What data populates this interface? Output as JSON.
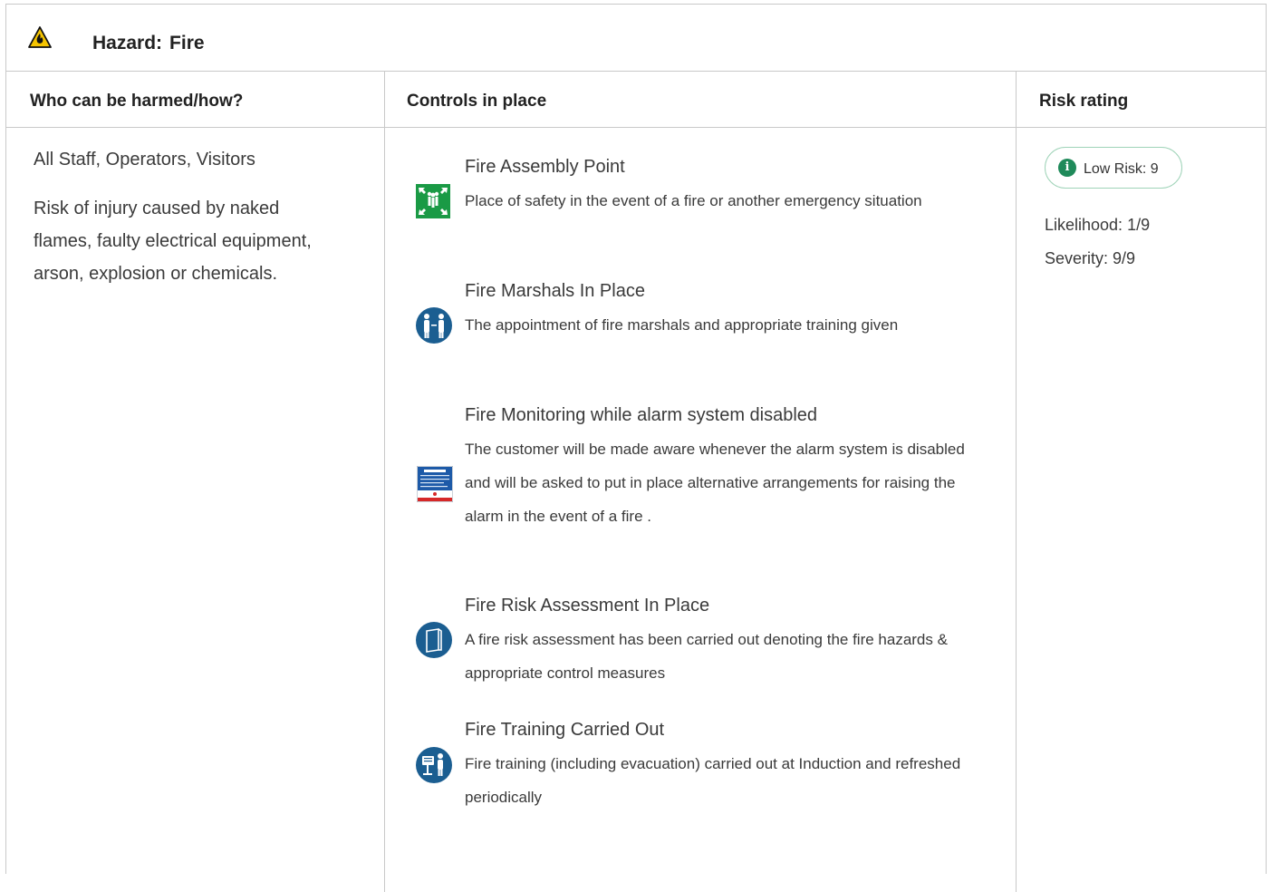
{
  "hazard": {
    "label": "Hazard:",
    "name": "Fire",
    "icon": "fire-warning-triangle-icon"
  },
  "columns": {
    "who": "Who can be harmed/how?",
    "controls": "Controls in place",
    "risk": "Risk rating"
  },
  "harm": {
    "who": "All Staff, Operators, Visitors",
    "description": "Risk of injury caused by naked flames, faulty electrical equipment, arson, explosion or chemicals."
  },
  "controls": [
    {
      "title": "Fire Assembly Point",
      "description": "Place of safety in the event of a fire or another emergency situation",
      "icon": "assembly-point-icon"
    },
    {
      "title": "Fire Marshals In Place",
      "description": "The appointment of fire marshals and appropriate training given",
      "icon": "fire-marshal-icon"
    },
    {
      "title": "Fire Monitoring while alarm system disabled",
      "description": "The customer will be made aware whenever the alarm system is disabled and will be asked to put in place alternative arrangements for raising the alarm in the event of a fire .",
      "icon": "fire-action-notice-icon"
    },
    {
      "title": "Fire Risk Assessment In Place",
      "description": "A fire risk assessment has been carried out denoting the fire hazards & appropriate control measures",
      "icon": "risk-assessment-document-icon"
    },
    {
      "title": "Fire Training Carried Out",
      "description": "Fire training (including evacuation) carried out at Induction and refreshed periodically",
      "icon": "training-icon"
    }
  ],
  "risk": {
    "badge": "Low Risk: 9",
    "badge_color": "#1f8a5a",
    "likelihood": "Likelihood: 1/9",
    "severity": "Severity: 9/9"
  }
}
